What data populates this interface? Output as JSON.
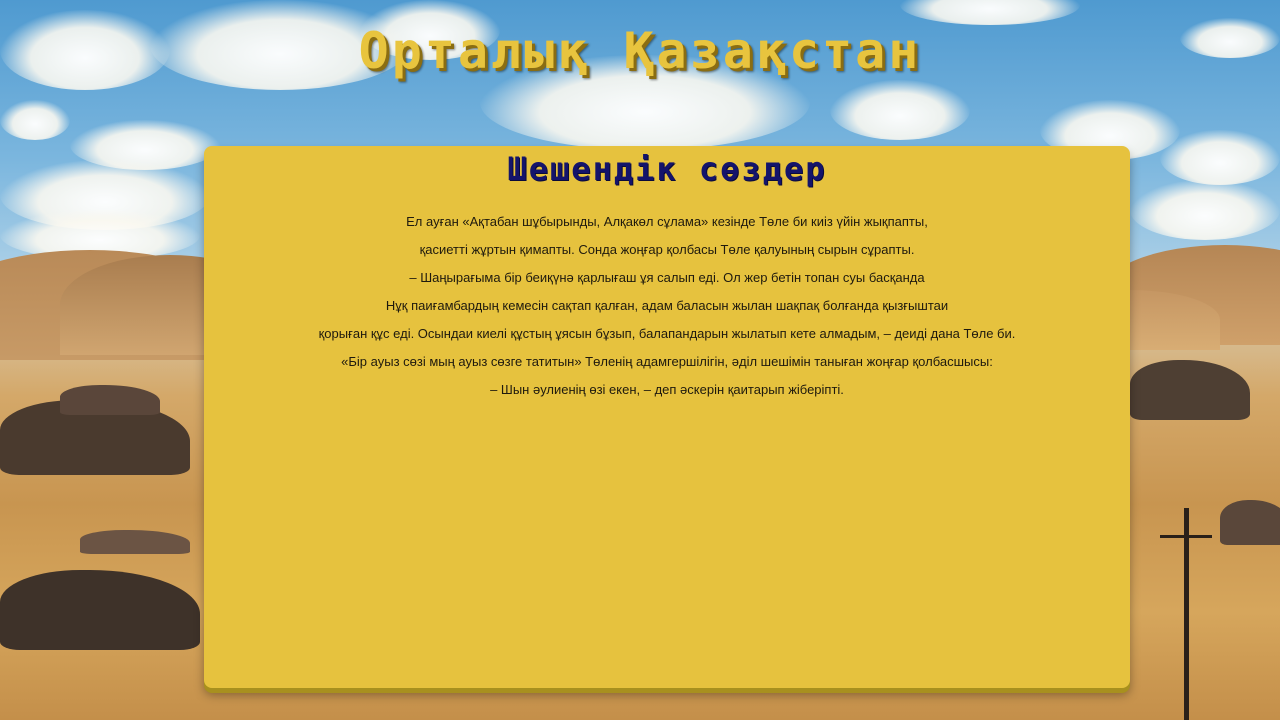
{
  "header": {
    "title": "Орталық Қазақстан"
  },
  "panel": {
    "title": "Шешендік сөздер",
    "lines": [
      "Ел ауған «Ақтабан шұбырынды, Алқакөл сұлама» кезінде Төле би киіз үйін жықпапты,",
      "қасиетті жұртын қимапты. Сонда жоңғар қолбасы Төле қалуының сырын сұрапты.",
      "– Шаңырағыма бір беиқүнә қарлығаш ұя салып еді. Ол жер бетін топан суы басқанда",
      "Нұқ паиғамбардың кемесін сақтап қалған, адам баласын жылан шақпақ болғанда қызғыштаи",
      "қорыған құс еді. Осындаи киелі құстың ұясын бұзып, балапандарын жылатып кете алмадым, – деиді дана Төле би.",
      "«Бір ауыз сөзі мың ауыз сөзге татитын» Төленің адамгершілігін, әділ шешімін таныған жоңғар қолбасшысы:",
      "– Шын әулиенің өзі екен, – деп әскерін қаитарып жіберіпті."
    ]
  },
  "colors": {
    "panel": "#e6c23e",
    "title_text": "#e8c43e",
    "panel_title_text": "#14146b"
  }
}
